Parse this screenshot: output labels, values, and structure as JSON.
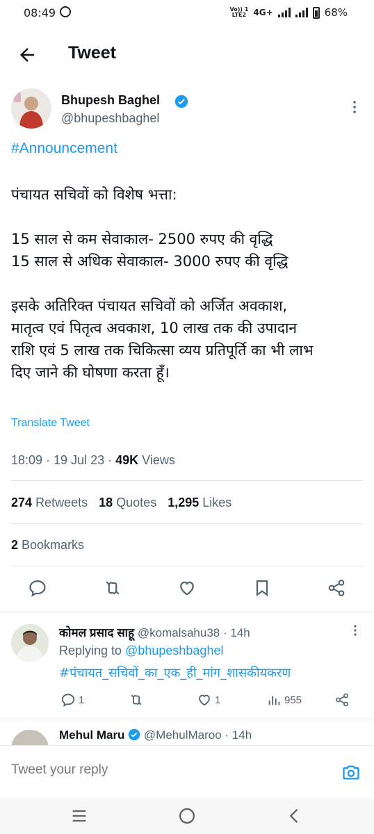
{
  "status_bar": {
    "time": "08:49",
    "volte_line1": "Vo)) 1",
    "volte_line2": "LTE2",
    "network": "4G+",
    "battery_level": 68,
    "battery": "68%"
  },
  "header": {
    "title": "Tweet"
  },
  "author": {
    "name": "Bhupesh Baghel",
    "handle": "@bhupeshbaghel",
    "verified": true
  },
  "tweet": {
    "hashtag": "#Announcement",
    "lines": [
      "पंचायत सचिवों को विशेष भत्ता:",
      "",
      "15 साल से कम सेवाकाल- 2500 रुपए की वृद्धि",
      "15 साल से अधिक सेवाकाल- 3000 रुपए की वृद्धि",
      "",
      "इसके अतिरिक्त पंचायत सचिवों को अर्जित अवकाश,",
      "मातृत्व एवं पितृत्व अवकाश, 10 लाख तक की उपादान",
      "राशि एवं 5 लाख तक चिकित्सा व्यय प्रतिपूर्ति का भी लाभ",
      "दिए जाने की घोषणा करता हूँ।"
    ],
    "translate_label": "Translate Tweet",
    "time": "18:09",
    "date": "19 Jul 23",
    "views_count": "49K",
    "views_label": "Views"
  },
  "stats": {
    "retweets_count": "274",
    "retweets_label": "Retweets",
    "quotes_count": "18",
    "quotes_label": "Quotes",
    "likes_count": "1,295",
    "likes_label": "Likes",
    "bookmarks_count": "2",
    "bookmarks_label": "Bookmarks"
  },
  "actions": [
    "reply-icon",
    "retweet-icon",
    "like-icon",
    "bookmark-icon",
    "share-icon"
  ],
  "reply": {
    "name": "कोमल प्रसाद साहू",
    "handle": "@komalsahu38",
    "time": "· 14h",
    "replying_label": "Replying to",
    "replying_handle": "@bhupeshbaghel",
    "text": "#पंचायत_सचिवों_का_एक_ही_मांग_शासकीयकरण",
    "reply_count": "1",
    "like_count": "1",
    "views_count": "955"
  },
  "reply2": {
    "name": "Mehul Maru",
    "handle": "@MehulMaroo",
    "time": "· 14h"
  },
  "composer": {
    "placeholder": "Tweet your reply"
  },
  "colors": {
    "accent": "#1d9bf0",
    "secondary_text": "#536471",
    "text": "#0f1419"
  }
}
